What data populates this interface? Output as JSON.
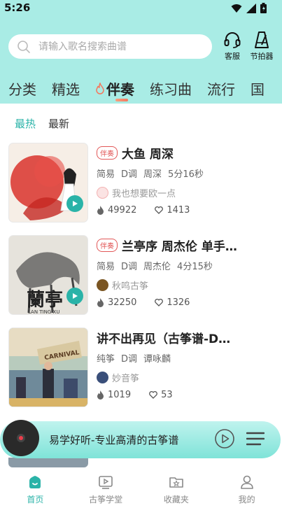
{
  "status_bar": {
    "time": "5:26"
  },
  "search": {
    "placeholder": "请输入歌名搜索曲谱"
  },
  "top_actions": {
    "service": "客服",
    "metronome": "节拍器"
  },
  "tabs": [
    "分类",
    "精选",
    "伴奏",
    "练习曲",
    "流行",
    "国"
  ],
  "active_tab": "伴奏",
  "subtabs": [
    "最热",
    "最新"
  ],
  "active_subtab": "最热",
  "items": [
    {
      "tag": "伴奏",
      "title": "大鱼 周深",
      "meta": [
        "简易",
        "D调",
        "周深",
        "5分16秒"
      ],
      "author": "我也想要欧一点",
      "plays": "49922",
      "likes": "1413"
    },
    {
      "tag": "伴奏",
      "title": "兰亭序 周杰伦 单手…",
      "meta": [
        "简易",
        "D调",
        "周杰伦",
        "4分15秒"
      ],
      "author": "秋鸣古筝",
      "plays": "32250",
      "likes": "1326",
      "thumb_text": "LAN TING XU"
    },
    {
      "tag": "",
      "title": "讲不出再见（古筝谱-D…",
      "meta": [
        "纯筝",
        "D调",
        "谭咏麟"
      ],
      "author": "妙音筝",
      "plays": "1019",
      "likes": "53",
      "thumb_text": "CARNIVAL"
    }
  ],
  "player": {
    "title": "易学好听-专业高清的古筝谱"
  },
  "bottom_nav": [
    {
      "label": "首页",
      "icon": "home-icon"
    },
    {
      "label": "古筝学堂",
      "icon": "video-play-icon"
    },
    {
      "label": "收藏夹",
      "icon": "folder-star-icon"
    },
    {
      "label": "我的",
      "icon": "profile-icon"
    }
  ],
  "colors": {
    "accent": "#2ab3a8",
    "header_bg": "#a9ece5",
    "tag_red": "#e25757"
  }
}
